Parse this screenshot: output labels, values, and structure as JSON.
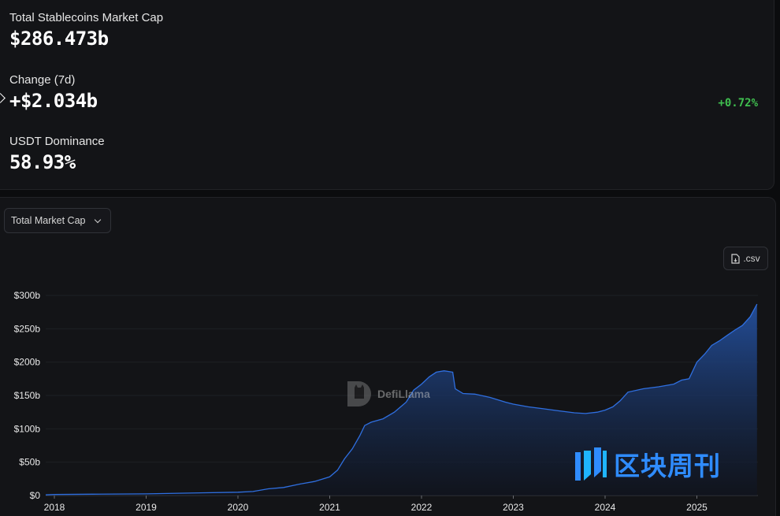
{
  "stats": {
    "total_label": "Total Stablecoins Market Cap",
    "total_value": "$286.473b",
    "change_label": "Change (7d)",
    "change_value": "+$2.034b",
    "change_pct": "+0.72%",
    "dominance_label": "USDT Dominance",
    "dominance_value": "58.93%"
  },
  "controls": {
    "metric_select": "Total Market Cap",
    "csv_label": ".csv"
  },
  "watermarks": {
    "defillama": "DefiLlama",
    "brand": "区块周刊"
  },
  "colors": {
    "line": "#2f6fe0",
    "area_top": "#24509e",
    "positive": "#3fbf4f",
    "brand": "#2f8cff"
  },
  "chart_data": {
    "type": "area",
    "title": "",
    "xlabel": "",
    "ylabel": "",
    "ylim": [
      0,
      300
    ],
    "y_ticks": [
      "$0",
      "$50b",
      "$100b",
      "$150b",
      "$200b",
      "$250b",
      "$300b"
    ],
    "x_ticks": [
      "2018",
      "2019",
      "2020",
      "2021",
      "2022",
      "2023",
      "2024",
      "2025"
    ],
    "grid": true,
    "legend": "none",
    "series": [
      {
        "x": [
          "2017-11-15",
          "2018-01-01",
          "2018-06-01",
          "2019-01-01",
          "2019-06-01",
          "2020-01-01",
          "2020-03-01",
          "2020-05-01",
          "2020-07-01",
          "2020-09-01",
          "2020-11-01",
          "2021-01-01",
          "2021-02-01",
          "2021-03-01",
          "2021-04-01",
          "2021-05-01",
          "2021-05-20",
          "2021-06-15",
          "2021-08-01",
          "2021-09-15",
          "2021-11-01",
          "2021-12-01",
          "2022-01-01",
          "2022-02-01",
          "2022-03-01",
          "2022-04-01",
          "2022-05-05",
          "2022-05-15",
          "2022-06-15",
          "2022-08-01",
          "2022-10-01",
          "2022-12-01",
          "2023-01-01",
          "2023-03-01",
          "2023-05-01",
          "2023-07-01",
          "2023-09-01",
          "2023-10-15",
          "2023-12-01",
          "2024-01-01",
          "2024-02-01",
          "2024-03-01",
          "2024-04-01",
          "2024-06-01",
          "2024-08-01",
          "2024-10-01",
          "2024-11-01",
          "2024-12-01",
          "2025-01-01",
          "2025-02-01",
          "2025-03-01",
          "2025-04-01",
          "2025-05-01",
          "2025-06-01",
          "2025-07-01",
          "2025-08-01",
          "2025-08-28"
        ],
        "y": [
          1,
          1.5,
          2,
          2.5,
          3.5,
          5,
          6,
          10,
          12,
          17,
          21,
          28,
          38,
          55,
          70,
          90,
          105,
          110,
          115,
          125,
          140,
          158,
          167,
          178,
          185,
          187,
          185,
          160,
          153,
          152,
          147,
          140,
          137,
          133,
          130,
          127,
          124,
          123,
          125,
          128,
          133,
          142,
          155,
          160,
          163,
          167,
          173,
          175,
          200,
          212,
          225,
          232,
          240,
          248,
          255,
          268,
          287
        ]
      }
    ]
  }
}
